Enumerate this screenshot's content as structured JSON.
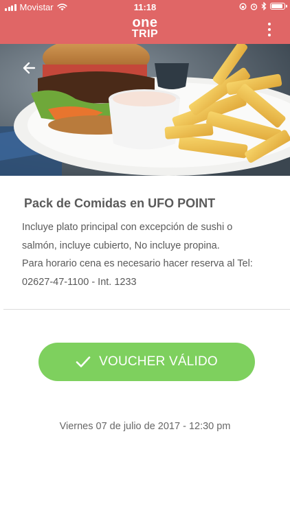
{
  "status_bar": {
    "carrier": "Movistar",
    "time": "11:18",
    "battery_level": 0.95
  },
  "header": {
    "logo_top": "one",
    "logo_bottom": "TRIP",
    "menu_icon": "more-vert-icon",
    "brand_color": "#e06666"
  },
  "hero": {
    "back_icon": "arrow-back-icon"
  },
  "offer": {
    "title": "Pack de Comidas en UFO POINT",
    "description": "Incluye plato principal con excepción de sushi o salmón, incluye cubierto, No incluye propina.\n Para horario cena es necesario hacer reserva al Tel: 02627-47-1100 - Int. 1233"
  },
  "voucher": {
    "label": "VOUCHER VÁLIDO",
    "icon": "checkmark-icon",
    "color": "#7ed05e"
  },
  "date": "Viernes 07 de julio de 2017 - 12:30 pm"
}
